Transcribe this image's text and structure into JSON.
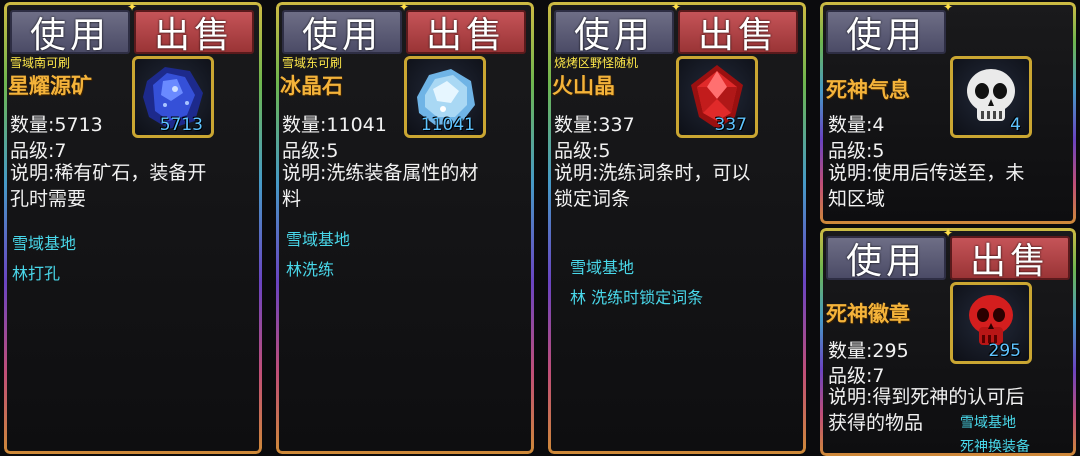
{
  "use_label": "使用",
  "sell_label": "出售",
  "cards": [
    {
      "tip": "雪域南可刷",
      "name": "星耀源矿",
      "count": "5713",
      "quantity": "数量:5713",
      "grade": "品级:7",
      "desc1": "说明:稀有矿石，装备开",
      "desc2": "孔时需要",
      "loc1": "雪域基地",
      "loc2": "林打孔",
      "icon": "blue-crystal-ore-icon",
      "icon_color": "#2b4fd8"
    },
    {
      "tip": "雪域东可刷",
      "name": "冰晶石",
      "count": "11041",
      "quantity": "数量:11041",
      "grade": "品级:5",
      "desc1": "说明:洗练装备属性的材",
      "desc2": "料",
      "loc1": "雪域基地",
      "loc2": "林洗练",
      "icon": "ice-crystal-icon",
      "icon_color": "#a9d8f4"
    },
    {
      "tip": "烧烤区野怪随机",
      "name": "火山晶",
      "count": "337",
      "quantity": "数量:337",
      "grade": "品级:5",
      "desc1": "说明:洗练词条时，可以",
      "desc2": "锁定词条",
      "loc1": "雪域基地",
      "loc2": "林  洗练时锁定词条",
      "icon": "red-gem-icon",
      "icon_color": "#e02a2a"
    },
    {
      "name": "死神气息",
      "count": "4",
      "quantity": "数量:4",
      "grade": "品级:5",
      "desc1": "说明:使用后传送至，未",
      "desc2": "知区域",
      "icon": "white-skull-icon",
      "icon_color": "#eaeaea"
    },
    {
      "name": "死神徽章",
      "count": "295",
      "quantity": "数量:295",
      "grade": "品级:7",
      "desc1": "说明:得到死神的认可后",
      "desc2": "获得的物品",
      "loc1": "雪域基地",
      "loc2": "死神换装备",
      "icon": "red-skull-icon",
      "icon_color": "#d41e1e"
    }
  ]
}
